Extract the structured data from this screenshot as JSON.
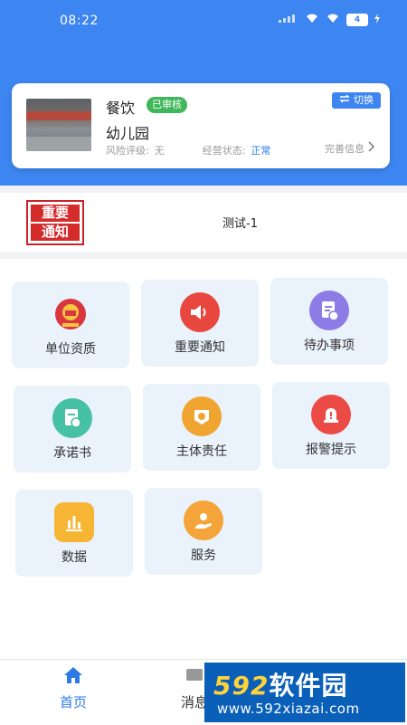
{
  "status_bar": {
    "time": "08:22",
    "battery": "4"
  },
  "unit_card": {
    "category": "餐饮",
    "audit_status": "已审核",
    "switch_label": "切换",
    "name": "幼儿园",
    "risk_label": "风险评级:",
    "risk_value": "无",
    "business_label": "经营状态:",
    "business_value": "正常",
    "complete_info": "完善信息"
  },
  "notice": {
    "logo_line1": "重要",
    "logo_line2": "通知",
    "text": "测试-1"
  },
  "grid": {
    "items": [
      {
        "label": "单位资质",
        "icon": "national-emblem-icon",
        "color": "#d9363e"
      },
      {
        "label": "重要通知",
        "icon": "speaker-icon",
        "color": "#e8473f"
      },
      {
        "label": "待办事项",
        "icon": "todo-document-icon",
        "color": "#8e7ce6"
      },
      {
        "label": "承诺书",
        "icon": "commitment-document-icon",
        "color": "#46c1a6"
      },
      {
        "label": "主体责任",
        "icon": "responsibility-badge-icon",
        "color": "#f1a531"
      },
      {
        "label": "报警提示",
        "icon": "alarm-light-icon",
        "color": "#ec4a44"
      },
      {
        "label": "数据",
        "icon": "bar-chart-icon",
        "color": "#f6b532"
      },
      {
        "label": "服务",
        "icon": "service-hand-icon",
        "color": "#f5a43a"
      }
    ]
  },
  "tabbar": {
    "home": "首页",
    "messages": "消息"
  },
  "watermark": {
    "brand_num": "592",
    "brand_text": "软件园",
    "url": "www.592xiazai.com"
  },
  "colors": {
    "primary": "#3d85f0",
    "tile_bg": "#eaf2fb",
    "audit_green": "#3fb75a"
  }
}
